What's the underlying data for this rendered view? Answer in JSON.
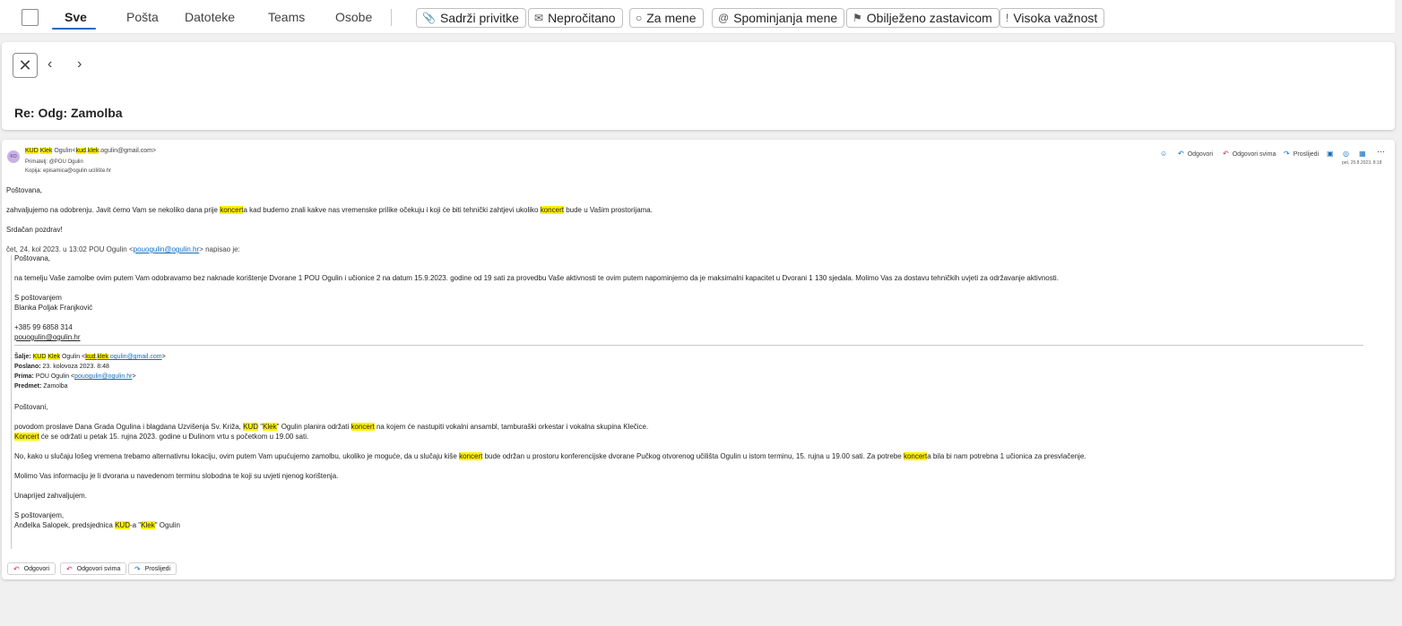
{
  "filter_bar": {
    "tabs": [
      "Sve",
      "Pošta",
      "Datoteke",
      "Teams",
      "Osobe"
    ],
    "chips": [
      {
        "label": "Sadrži privitke",
        "icon": "paperclip-icon"
      },
      {
        "label": "Nepročitano",
        "icon": "envelope-icon"
      },
      {
        "label": "Za mene",
        "icon": "person-icon"
      },
      {
        "label": "Spominjanja mene",
        "icon": "at-icon"
      },
      {
        "label": "Obilježeno zastavicom",
        "icon": "flag-icon"
      },
      {
        "label": "Visoka važnost",
        "icon": "exclamation-icon"
      }
    ]
  },
  "header": {
    "subject": "Re: Odg: Zamolba"
  },
  "message": {
    "avatar_initials": "KO",
    "from": {
      "hl1": "KUD",
      "hl2": "Klek",
      "name": "Ogulin",
      "email_pre": "<",
      "email_hl1": "kud",
      "email_hl2": "klek",
      "email_post": ".ogulin@gmail.com>"
    },
    "to_label": "Primatelj:",
    "to_name": "@POU Ogulin",
    "cc_label": "Kopija:",
    "cc_value": "episamica@ogulin ucilište.hr",
    "date": "pet, 25.8.2023. 8:18",
    "actions": {
      "reply": "Odgovori",
      "reply_all": "Odgovori svima",
      "forward": "Proslijedi"
    },
    "greeting": "Poštovana,",
    "line1": {
      "a": "zahvaljujemo na odobrenju. Javit ćemo Vam se nekoliko dana prije ",
      "h1": "koncert",
      "b": "a kad budemo znali kakve nas vremenske prilike očekuju i koji će biti tehnički zahtjevi ukoliko ",
      "h2": "koncert",
      "c": " bude u Vašim prostorijama."
    },
    "closing": "Srdačan pozdrav!",
    "wrote": {
      "a": "čet, 24. kol 2023. u 13:02 POU Ogulin <",
      "link": "pouogulin@ogulin.hr",
      "b": "> napisao je:"
    },
    "q1": {
      "greeting": "Poštovana,",
      "text": "na temelju Vaše zamolbe ovim putem Vam odobravamo bez naknade korištenje Dvorane 1 POU Ogulin i učionice 2 na datum 15.9.2023. godine od 19 sati za provedbu Vaše aktivnosti te ovim putem napominjemo da je maksimalni kapacitet u Dvorani 1 130 sjedala. Molimo Vas za dostavu tehničkih uvjeti za održavanje aktivnosti.",
      "regards": "S poštovanjem",
      "name": "Blanka Poljak Franjković",
      "phone": "+385 99 6858 314",
      "email": "pouogulin@ogulin.hr"
    },
    "q2": {
      "from_label": "Šalje:",
      "from": {
        "hl1": "KUD",
        "hl2": "Klek",
        "name": "Ogulin <",
        "link_hl1": "kud",
        "link_hl2": "klek",
        "link_post": ".ogulin@gmail.com",
        "end": ">"
      },
      "sent_label": "Poslano:",
      "sent": "23. kolovoza 2023. 8:48",
      "to_label": "Prima:",
      "to": {
        "a": "POU Ogulin <",
        "link": "pouogulin@ogulin.hr",
        "b": ">"
      },
      "subject_label": "Predmet:",
      "subject": "Zamolba",
      "greeting": "Poštovani,",
      "p1": {
        "a": "povodom proslave Dana Grada Ogulina i blagdana Uzvišenja Sv. Križa, ",
        "h1": "KUD",
        "b": " \"",
        "h2": "Klek",
        "c": "\" Ogulin planira održati ",
        "h3": "koncert",
        "d": " na kojem će nastupiti vokalni ansambl, tamburaški orkestar i vokalna skupina Klečice."
      },
      "p1b": {
        "h": "Koncert",
        "a": " će se održati u petak 15. rujna 2023. godine u Đulinom vrtu s početkom u 19.00 sati."
      },
      "p2": {
        "a": "No, kako u slučaju lošeg vremena trebamo alternativnu lokaciju, ovim putem Vam upućujemo zamolbu, ukoliko je moguće, da u slučaju kiše ",
        "h1": "koncert",
        "b": " bude održan u prostoru konferencijske dvorane Pučkog otvorenog učilišta Ogulin u istom terminu, 15. rujna u 19.00 sati. Za potrebe ",
        "h2": "koncert",
        "c": "a bila bi nam potrebna 1 učionica za presvlačenje."
      },
      "p3": "Molimo Vas informaciju je li dvorana u navedenom terminu slobodna te koji su uvjeti njenog korištenja.",
      "p4": "Unaprijed zahvaljujem.",
      "regards": "S poštovanjem,",
      "sig": {
        "a": "Anđelka Salopek, predsjednica ",
        "h1": "KUD",
        "b": "-a \"",
        "h2": "Klek",
        "c": "\" Ogulin"
      }
    },
    "footer": {
      "reply": "Odgovori",
      "reply_all": "Odgovori svima",
      "forward": "Proslijedi"
    }
  }
}
